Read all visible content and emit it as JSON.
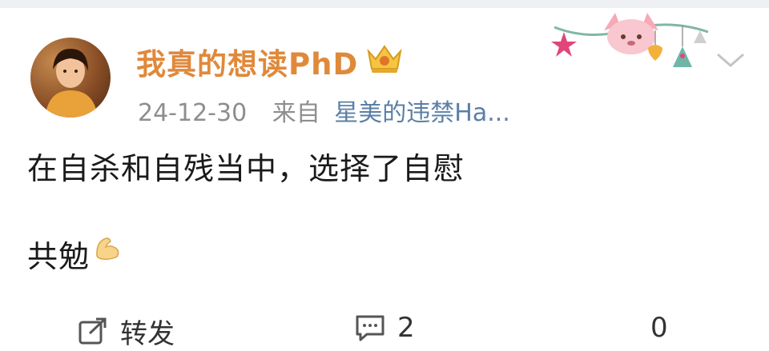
{
  "post": {
    "username": "我真的想读PhD",
    "date": "24-12-30",
    "from_label": "来自",
    "source": "星美的违禁Ha...",
    "content_line1": "在自杀和自残当中，选择了自慰",
    "content_line2": "共勉"
  },
  "actions": {
    "repost_label": "转发",
    "comment_count": "2",
    "like_count": "0"
  },
  "icons": {
    "badge": "crown-vip-icon",
    "decoration": "cartoon-fox-banner",
    "menu": "chevron-down-icon",
    "repost": "repost-icon",
    "comment": "comment-icon",
    "emoji": "flexed-biceps"
  },
  "colors": {
    "username": "#e0893b",
    "source_link": "#5b7fa6",
    "meta_text": "#8e8e8e",
    "body_text": "#1a1a1a"
  }
}
